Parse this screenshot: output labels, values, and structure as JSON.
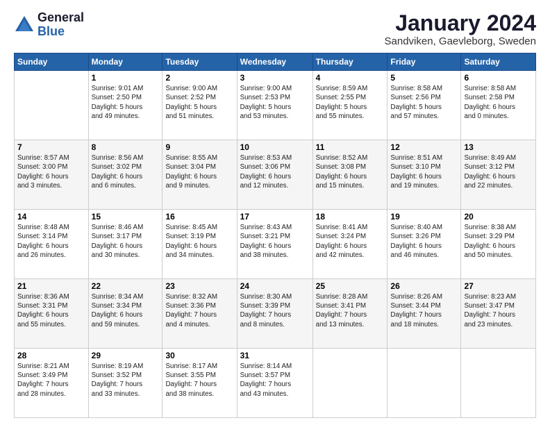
{
  "logo": {
    "general": "General",
    "blue": "Blue"
  },
  "header": {
    "title": "January 2024",
    "subtitle": "Sandviken, Gaevleborg, Sweden"
  },
  "days_of_week": [
    "Sunday",
    "Monday",
    "Tuesday",
    "Wednesday",
    "Thursday",
    "Friday",
    "Saturday"
  ],
  "weeks": [
    [
      {
        "day": "",
        "info": ""
      },
      {
        "day": "1",
        "info": "Sunrise: 9:01 AM\nSunset: 2:50 PM\nDaylight: 5 hours\nand 49 minutes."
      },
      {
        "day": "2",
        "info": "Sunrise: 9:00 AM\nSunset: 2:52 PM\nDaylight: 5 hours\nand 51 minutes."
      },
      {
        "day": "3",
        "info": "Sunrise: 9:00 AM\nSunset: 2:53 PM\nDaylight: 5 hours\nand 53 minutes."
      },
      {
        "day": "4",
        "info": "Sunrise: 8:59 AM\nSunset: 2:55 PM\nDaylight: 5 hours\nand 55 minutes."
      },
      {
        "day": "5",
        "info": "Sunrise: 8:58 AM\nSunset: 2:56 PM\nDaylight: 5 hours\nand 57 minutes."
      },
      {
        "day": "6",
        "info": "Sunrise: 8:58 AM\nSunset: 2:58 PM\nDaylight: 6 hours\nand 0 minutes."
      }
    ],
    [
      {
        "day": "7",
        "info": "Sunrise: 8:57 AM\nSunset: 3:00 PM\nDaylight: 6 hours\nand 3 minutes."
      },
      {
        "day": "8",
        "info": "Sunrise: 8:56 AM\nSunset: 3:02 PM\nDaylight: 6 hours\nand 6 minutes."
      },
      {
        "day": "9",
        "info": "Sunrise: 8:55 AM\nSunset: 3:04 PM\nDaylight: 6 hours\nand 9 minutes."
      },
      {
        "day": "10",
        "info": "Sunrise: 8:53 AM\nSunset: 3:06 PM\nDaylight: 6 hours\nand 12 minutes."
      },
      {
        "day": "11",
        "info": "Sunrise: 8:52 AM\nSunset: 3:08 PM\nDaylight: 6 hours\nand 15 minutes."
      },
      {
        "day": "12",
        "info": "Sunrise: 8:51 AM\nSunset: 3:10 PM\nDaylight: 6 hours\nand 19 minutes."
      },
      {
        "day": "13",
        "info": "Sunrise: 8:49 AM\nSunset: 3:12 PM\nDaylight: 6 hours\nand 22 minutes."
      }
    ],
    [
      {
        "day": "14",
        "info": "Sunrise: 8:48 AM\nSunset: 3:14 PM\nDaylight: 6 hours\nand 26 minutes."
      },
      {
        "day": "15",
        "info": "Sunrise: 8:46 AM\nSunset: 3:17 PM\nDaylight: 6 hours\nand 30 minutes."
      },
      {
        "day": "16",
        "info": "Sunrise: 8:45 AM\nSunset: 3:19 PM\nDaylight: 6 hours\nand 34 minutes."
      },
      {
        "day": "17",
        "info": "Sunrise: 8:43 AM\nSunset: 3:21 PM\nDaylight: 6 hours\nand 38 minutes."
      },
      {
        "day": "18",
        "info": "Sunrise: 8:41 AM\nSunset: 3:24 PM\nDaylight: 6 hours\nand 42 minutes."
      },
      {
        "day": "19",
        "info": "Sunrise: 8:40 AM\nSunset: 3:26 PM\nDaylight: 6 hours\nand 46 minutes."
      },
      {
        "day": "20",
        "info": "Sunrise: 8:38 AM\nSunset: 3:29 PM\nDaylight: 6 hours\nand 50 minutes."
      }
    ],
    [
      {
        "day": "21",
        "info": "Sunrise: 8:36 AM\nSunset: 3:31 PM\nDaylight: 6 hours\nand 55 minutes."
      },
      {
        "day": "22",
        "info": "Sunrise: 8:34 AM\nSunset: 3:34 PM\nDaylight: 6 hours\nand 59 minutes."
      },
      {
        "day": "23",
        "info": "Sunrise: 8:32 AM\nSunset: 3:36 PM\nDaylight: 7 hours\nand 4 minutes."
      },
      {
        "day": "24",
        "info": "Sunrise: 8:30 AM\nSunset: 3:39 PM\nDaylight: 7 hours\nand 8 minutes."
      },
      {
        "day": "25",
        "info": "Sunrise: 8:28 AM\nSunset: 3:41 PM\nDaylight: 7 hours\nand 13 minutes."
      },
      {
        "day": "26",
        "info": "Sunrise: 8:26 AM\nSunset: 3:44 PM\nDaylight: 7 hours\nand 18 minutes."
      },
      {
        "day": "27",
        "info": "Sunrise: 8:23 AM\nSunset: 3:47 PM\nDaylight: 7 hours\nand 23 minutes."
      }
    ],
    [
      {
        "day": "28",
        "info": "Sunrise: 8:21 AM\nSunset: 3:49 PM\nDaylight: 7 hours\nand 28 minutes."
      },
      {
        "day": "29",
        "info": "Sunrise: 8:19 AM\nSunset: 3:52 PM\nDaylight: 7 hours\nand 33 minutes."
      },
      {
        "day": "30",
        "info": "Sunrise: 8:17 AM\nSunset: 3:55 PM\nDaylight: 7 hours\nand 38 minutes."
      },
      {
        "day": "31",
        "info": "Sunrise: 8:14 AM\nSunset: 3:57 PM\nDaylight: 7 hours\nand 43 minutes."
      },
      {
        "day": "",
        "info": ""
      },
      {
        "day": "",
        "info": ""
      },
      {
        "day": "",
        "info": ""
      }
    ]
  ]
}
